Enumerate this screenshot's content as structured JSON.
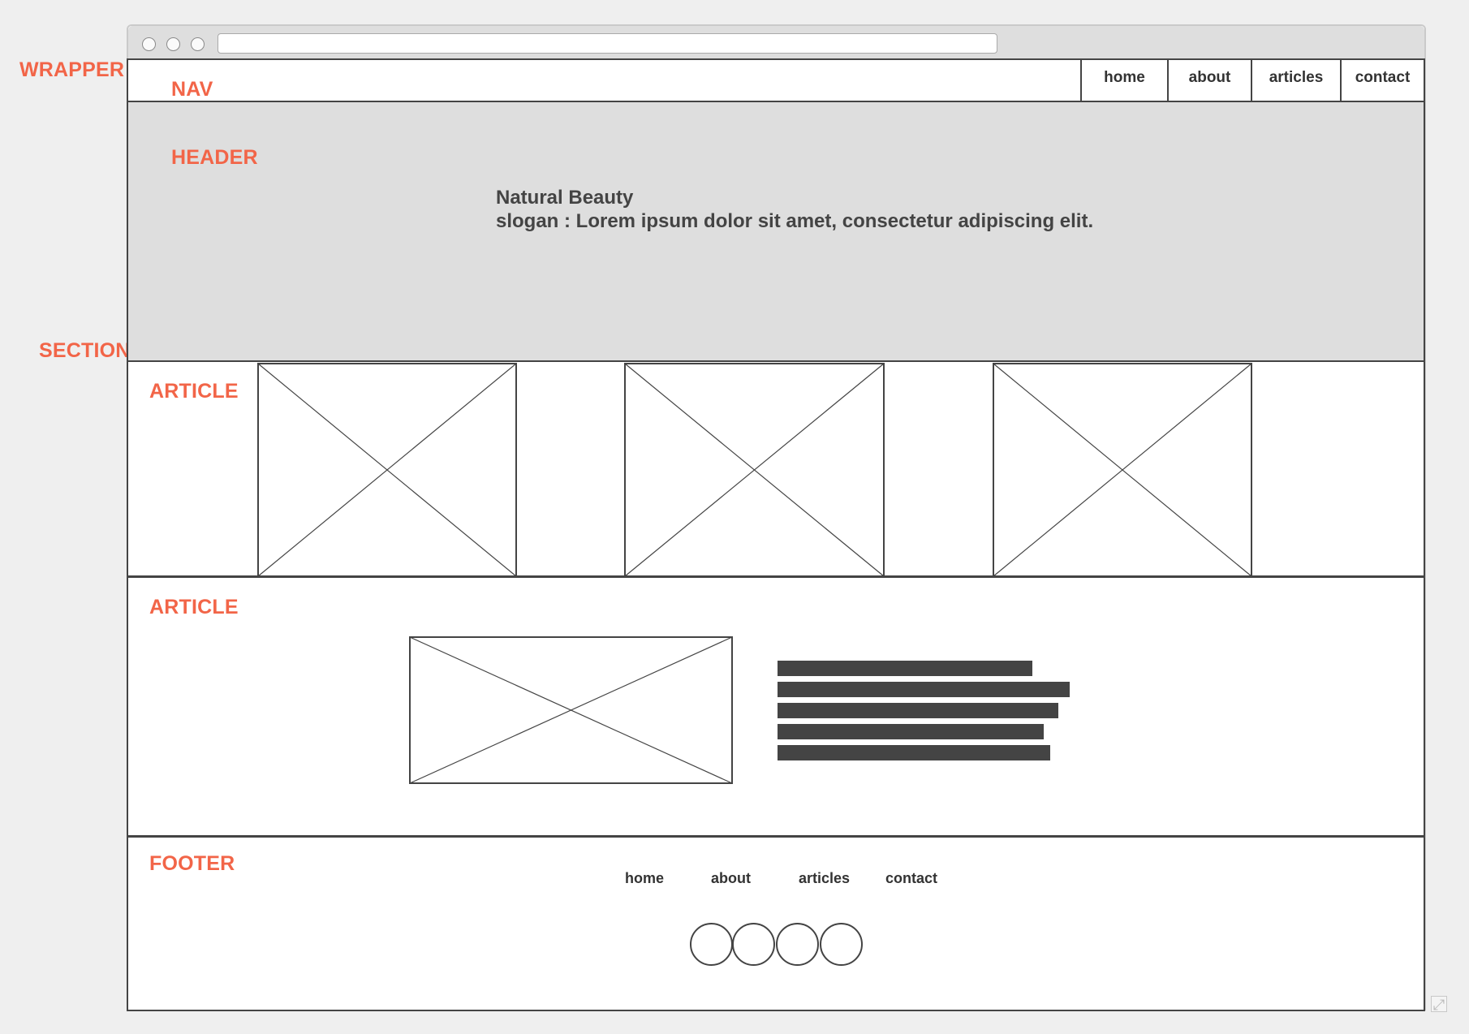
{
  "labels": {
    "wrapper": "WRAPPER",
    "nav": "NAV",
    "header": "HEADER",
    "section": "SECTION",
    "article_1": "ARTICLE",
    "article_2": "ARTICLE",
    "footer": "FOOTER"
  },
  "browser": {
    "url": ""
  },
  "nav": {
    "items": [
      {
        "label": "home"
      },
      {
        "label": "about"
      },
      {
        "label": "articles"
      },
      {
        "label": "contact"
      }
    ]
  },
  "header": {
    "title": "Natural Beauty",
    "slogan": "slogan : Lorem ipsum dolor sit amet, consectetur adipiscing elit."
  },
  "footer": {
    "links": [
      {
        "label": "home"
      },
      {
        "label": "about"
      },
      {
        "label": "articles"
      },
      {
        "label": "contact"
      }
    ],
    "social_count": 4
  },
  "colors": {
    "annotation": "#f26548",
    "wireframe": "#444444",
    "header_bg": "#dedede",
    "background": "#efefef"
  },
  "icons": [
    "close-window-icon",
    "minimize-window-icon",
    "maximize-window-icon",
    "resize-icon",
    "image-placeholder-icon",
    "social-icon"
  ]
}
